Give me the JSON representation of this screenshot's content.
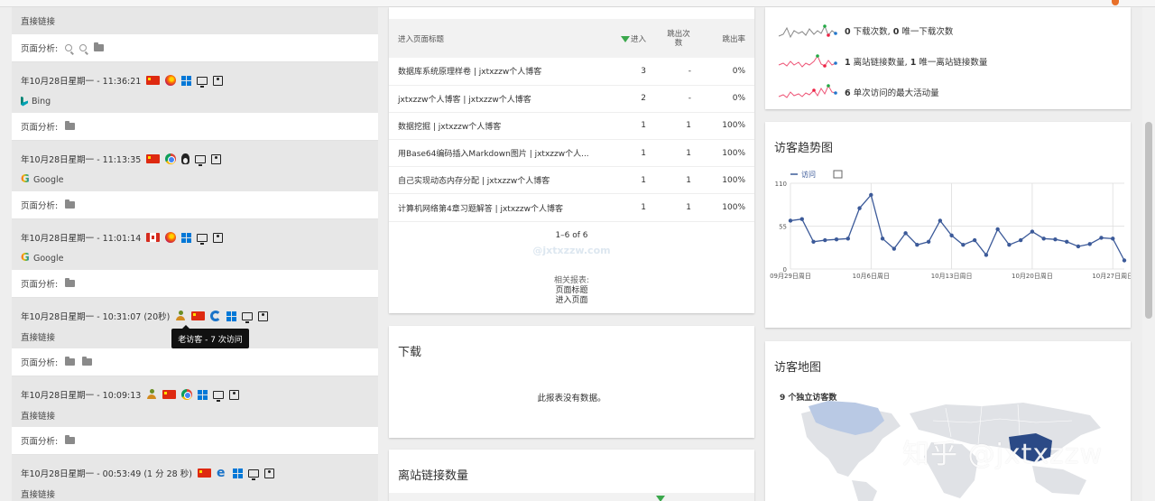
{
  "visitor_log": {
    "top_referrer": "直接链接",
    "top_analysis_label": "页面分析:",
    "entries": [
      {
        "time": "年10月28日星期一 - 11:36:21",
        "referrer": "Bing",
        "analysis_label": "页面分析:"
      },
      {
        "time": "年10月28日星期一 - 11:13:35",
        "referrer": "Google",
        "analysis_label": "页面分析:"
      },
      {
        "time": "年10月28日星期一 - 11:01:14",
        "referrer": "Google",
        "analysis_label": "页面分析:"
      },
      {
        "time": "年10月28日星期一 - 10:31:07 (20秒)",
        "referrer": "直接链接",
        "analysis_label": "页面分析:"
      },
      {
        "time": "年10月28日星期一 - 10:09:13",
        "referrer": "直接链接",
        "analysis_label": "页面分析:"
      },
      {
        "time": "年10月28日星期一 - 00:53:49 (1 分 28 秒)",
        "referrer": "直接链接"
      }
    ],
    "tooltip": "老访客 - 7 次访问"
  },
  "entry_pages": {
    "columns": [
      "进入页面标题",
      "进入",
      "跳出次数",
      "跳出率"
    ],
    "rows": [
      [
        "数据库系统原理样卷 | jxtxzzw个人博客",
        "3",
        "-",
        "0%"
      ],
      [
        "jxtxzzw个人博客 | jxtxzzw个人博客",
        "2",
        "-",
        "0%"
      ],
      [
        "数据挖掘 | jxtxzzw个人博客",
        "1",
        "1",
        "100%"
      ],
      [
        "用Base64编码插入Markdown图片 | jxtxzzw个人...",
        "1",
        "1",
        "100%"
      ],
      [
        "自己实现动态内存分配 | jxtxzzw个人博客",
        "1",
        "1",
        "100%"
      ],
      [
        "计算机网络第4章习题解答 | jxtxzzw个人博客",
        "1",
        "1",
        "100%"
      ]
    ],
    "pager": "1–6 of 6",
    "watermark": "@jxtxzzw.com",
    "related_label": "相关报表:",
    "related_links": [
      "页面标题",
      "进入页面"
    ]
  },
  "downloads": {
    "title": "下载",
    "empty": "此报表没有数据。"
  },
  "referrers": {
    "title": "离站链接数量"
  },
  "sparklines": {
    "row1": {
      "a": "0",
      "a_text": " 下载次数, ",
      "b": "0",
      "b_text": " 唯一下载次数"
    },
    "row2": {
      "a": "1",
      "a_text": " 离站链接数量, ",
      "b": "1",
      "b_text": " 唯一离站链接数量"
    },
    "row3": {
      "a": "6",
      "a_text": " 单次访问的最大活动量"
    }
  },
  "trend": {
    "title": "访客趋势图",
    "legend": "访问"
  },
  "map": {
    "title": "访客地图",
    "subtitle": "9 个独立访客数"
  },
  "overlay": {
    "zhihu": "知乎 @jxtxzzw"
  },
  "chart_data": {
    "type": "line",
    "title": "访客趋势图",
    "series": [
      {
        "name": "访问",
        "values": [
          62,
          64,
          35,
          37,
          38,
          39,
          78,
          95,
          39,
          26,
          46,
          31,
          35,
          62,
          43,
          31,
          37,
          18,
          51,
          31,
          37,
          48,
          39,
          38,
          35,
          29,
          32,
          40,
          39,
          11
        ]
      }
    ],
    "x": [
      "09月29日周日",
      "09月30日",
      "10月1日",
      "10月2日",
      "10月3日",
      "10月4日",
      "10月5日",
      "10月6日周日",
      "10月7日",
      "10月8日",
      "10月9日",
      "10月10日",
      "10月11日",
      "10月12日",
      "10月13日周日",
      "10月14日",
      "10月15日",
      "10月16日",
      "10月17日",
      "10月18日",
      "10月19日",
      "10月20日周日",
      "10月21日",
      "10月22日",
      "10月23日",
      "10月24日",
      "10月25日",
      "10月26日",
      "10月27日周日",
      "10月28日"
    ],
    "x_tick_labels": [
      "09月29日周日",
      "10月6日周日",
      "10月13日周日",
      "10月20日周日",
      "10月27日周日"
    ],
    "y_ticks": [
      "0",
      "55",
      "110"
    ],
    "ylim": [
      0,
      110
    ],
    "grid": true,
    "color": "#3c5a99"
  }
}
